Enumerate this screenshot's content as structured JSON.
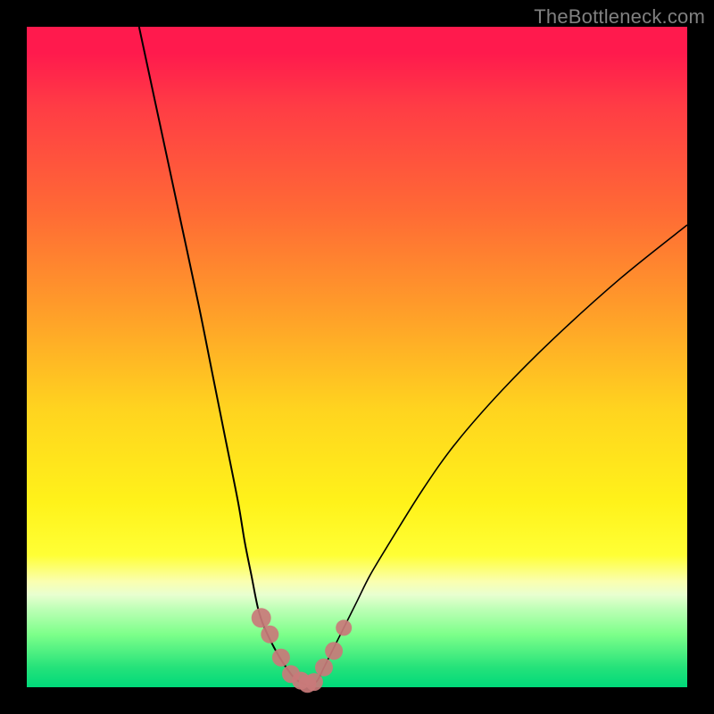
{
  "watermark": "TheBottleneck.com",
  "colors": {
    "frame": "#000000",
    "gradient_top": "#ff1a4d",
    "gradient_mid": "#fff21a",
    "gradient_bottom": "#00d97a",
    "curve": "#000000",
    "markers": "#c97a7a"
  },
  "chart_data": {
    "type": "line",
    "title": "",
    "xlabel": "",
    "ylabel": "",
    "xlim": [
      0,
      100
    ],
    "ylim": [
      0,
      100
    ],
    "series": [
      {
        "name": "left-curve",
        "x": [
          17,
          20,
          23,
          26,
          28,
          30,
          32,
          33,
          34,
          35,
          36,
          38,
          40,
          41,
          42,
          43
        ],
        "y": [
          100,
          86,
          72,
          58,
          48,
          38,
          28,
          22,
          17,
          12,
          9,
          5,
          2,
          1,
          0.5,
          0
        ]
      },
      {
        "name": "right-curve",
        "x": [
          43,
          44,
          45,
          46,
          48,
          50,
          52,
          55,
          60,
          65,
          72,
          80,
          90,
          100
        ],
        "y": [
          0,
          1,
          3,
          5,
          9,
          13,
          17,
          22,
          30,
          37,
          45,
          53,
          62,
          70
        ]
      }
    ],
    "markers": {
      "name": "highlight-points",
      "x": [
        35.5,
        36.8,
        38.5,
        40.0,
        41.5,
        42.5,
        43.5,
        45.0,
        46.5,
        48.0
      ],
      "y": [
        10.5,
        8.0,
        4.5,
        2.0,
        1.0,
        0.5,
        0.8,
        3.0,
        5.5,
        9.0
      ],
      "r": [
        11,
        10,
        10,
        10,
        10,
        10,
        10,
        10,
        10,
        9
      ]
    }
  }
}
